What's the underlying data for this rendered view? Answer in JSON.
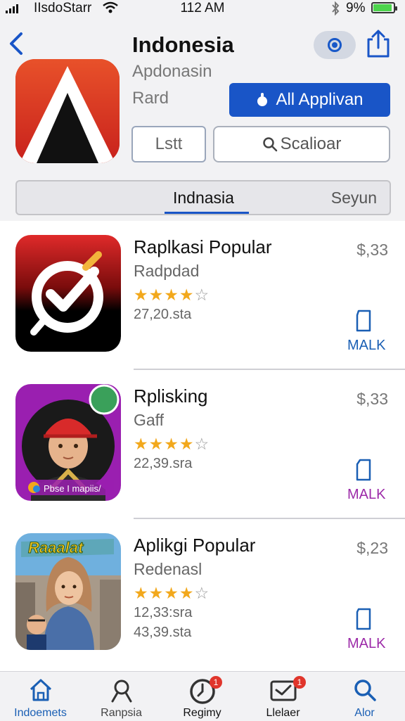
{
  "status_bar": {
    "carrier": "IIsdoStarr",
    "time": "112 AM",
    "battery": "9%"
  },
  "header": {
    "title": "Indonesia",
    "subtitle_1": "Apdonasin",
    "subtitle_2": "Rard",
    "primary_button": "All Applivan",
    "secondary_button": "Lstt",
    "search_label": "Scalioar"
  },
  "segments": [
    {
      "label": "Indnasia",
      "selected": true
    },
    {
      "label": "Seyun",
      "selected": false
    }
  ],
  "apps": [
    {
      "name": "Raplkasi Popular",
      "subtitle": "Radpdad",
      "rating": 4,
      "count": "27,20.sta",
      "count2": "",
      "price": "$,33",
      "action": "MALK",
      "action_color": "#1a5fb4",
      "icon": "checkmark-brush-icon"
    },
    {
      "name": "Rplisking",
      "subtitle": "Gaff",
      "rating": 4,
      "count": "22,39.sra",
      "count2": "",
      "price": "$,33",
      "action": "MALK",
      "action_color": "#9c2aa8",
      "icon": "avatar-boy-icon",
      "icon_caption": "Pbse I mapiis/"
    },
    {
      "name": "Aplikgi Popular",
      "subtitle": "Redenasl",
      "rating": 4,
      "count": "12,33:sra",
      "count2": "43,39.sta",
      "price": "$,23",
      "action": "MALK",
      "action_color": "#9c2aa8",
      "icon": "avatar-hijab-icon",
      "icon_caption": "Raaalat"
    }
  ],
  "tabs": [
    {
      "label": "Indoemets",
      "icon": "home-icon",
      "active": true,
      "badge": ""
    },
    {
      "label": "Ranpsia",
      "icon": "person-icon",
      "active": false,
      "badge": ""
    },
    {
      "label": "Regimy",
      "icon": "clock-icon",
      "active": false,
      "badge": "1"
    },
    {
      "label": "Llelaer",
      "icon": "inbox-icon",
      "active": false,
      "badge": "1"
    },
    {
      "label": "Alor",
      "icon": "search-icon",
      "active": true,
      "badge": ""
    }
  ],
  "colors": {
    "accent": "#1955c7",
    "star": "#f2a81c",
    "badge": "#e0352b"
  }
}
